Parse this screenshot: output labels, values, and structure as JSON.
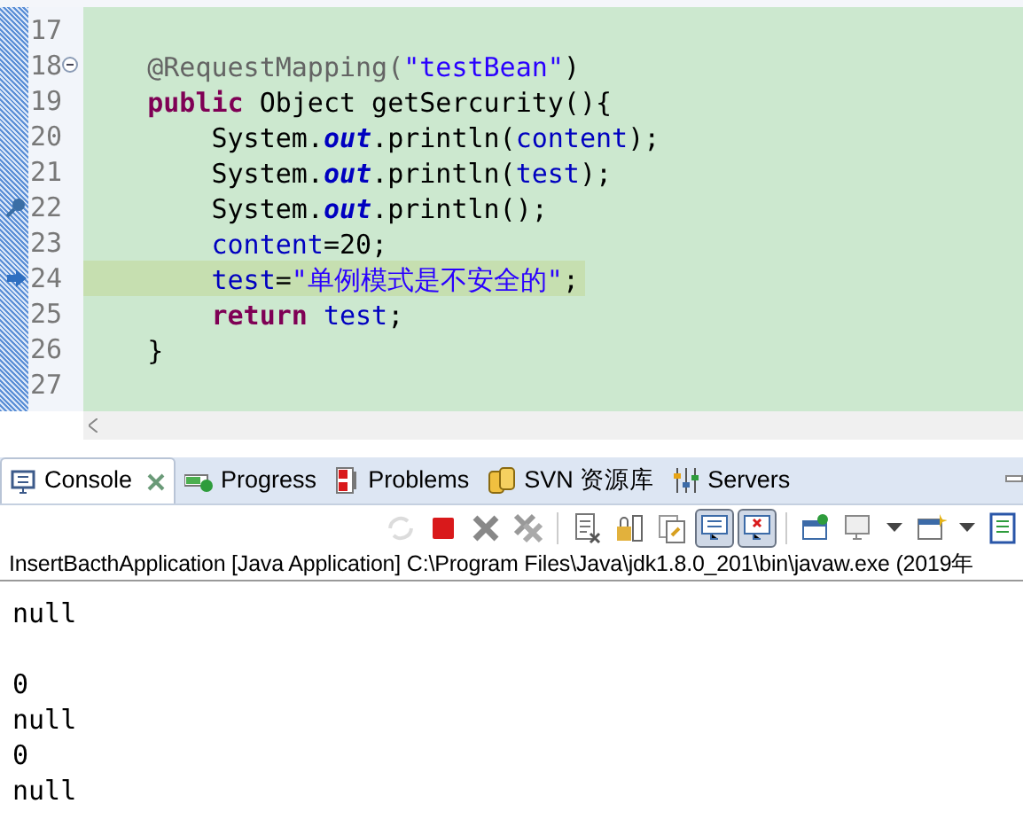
{
  "editor": {
    "lines": [
      {
        "number": "17",
        "fold_control": false,
        "breakpoint": false,
        "execution_arrow": false,
        "current": false
      },
      {
        "number": "18",
        "fold_control": true,
        "breakpoint": false,
        "execution_arrow": false,
        "current": false,
        "tokens": [
          {
            "kind": "annotation",
            "text": "    @RequestMapping("
          },
          {
            "kind": "string",
            "text": "\"testBean\""
          },
          {
            "kind": "plain",
            "text": ")"
          }
        ]
      },
      {
        "number": "19",
        "fold_control": false,
        "breakpoint": false,
        "execution_arrow": false,
        "current": false,
        "tokens": [
          {
            "kind": "keyword",
            "text": "    public"
          },
          {
            "kind": "plain",
            "text": " Object getSercurity(){"
          }
        ]
      },
      {
        "number": "20",
        "fold_control": false,
        "breakpoint": false,
        "execution_arrow": false,
        "current": false,
        "tokens": [
          {
            "kind": "plain",
            "text": "        System."
          },
          {
            "kind": "static",
            "text": "out"
          },
          {
            "kind": "plain",
            "text": ".println("
          },
          {
            "kind": "field",
            "text": "content"
          },
          {
            "kind": "plain",
            "text": ");"
          }
        ]
      },
      {
        "number": "21",
        "fold_control": false,
        "breakpoint": false,
        "execution_arrow": false,
        "current": false,
        "tokens": [
          {
            "kind": "plain",
            "text": "        System."
          },
          {
            "kind": "static",
            "text": "out"
          },
          {
            "kind": "plain",
            "text": ".println("
          },
          {
            "kind": "field",
            "text": "test"
          },
          {
            "kind": "plain",
            "text": ");"
          }
        ]
      },
      {
        "number": "22",
        "fold_control": false,
        "breakpoint": true,
        "execution_arrow": false,
        "current": false,
        "tokens": [
          {
            "kind": "plain",
            "text": "        System."
          },
          {
            "kind": "static",
            "text": "out"
          },
          {
            "kind": "plain",
            "text": ".println();"
          }
        ]
      },
      {
        "number": "23",
        "fold_control": false,
        "breakpoint": false,
        "execution_arrow": false,
        "current": false,
        "tokens": [
          {
            "kind": "field",
            "text": "        content"
          },
          {
            "kind": "plain",
            "text": "=20;"
          }
        ]
      },
      {
        "number": "24",
        "fold_control": false,
        "breakpoint": false,
        "execution_arrow": true,
        "current": true,
        "tokens": [
          {
            "kind": "field",
            "text": "        test"
          },
          {
            "kind": "plain",
            "text": "="
          },
          {
            "kind": "string",
            "text": "\"单例模式是不安全的\""
          },
          {
            "kind": "plain",
            "text": ";"
          }
        ]
      },
      {
        "number": "25",
        "fold_control": false,
        "breakpoint": false,
        "execution_arrow": false,
        "current": false,
        "tokens": [
          {
            "kind": "keyword",
            "text": "        return"
          },
          {
            "kind": "field",
            "text": " test"
          },
          {
            "kind": "plain",
            "text": ";"
          }
        ]
      },
      {
        "number": "26",
        "fold_control": false,
        "breakpoint": false,
        "execution_arrow": false,
        "current": false,
        "tokens": [
          {
            "kind": "plain",
            "text": "    }"
          }
        ]
      },
      {
        "number": "27",
        "fold_control": false,
        "breakpoint": false,
        "execution_arrow": false,
        "current": false
      }
    ]
  },
  "tabs": [
    {
      "label": "Console",
      "selected": true,
      "closable": true
    },
    {
      "label": "Progress",
      "selected": false,
      "closable": false
    },
    {
      "label": "Problems",
      "selected": false,
      "closable": false
    },
    {
      "label": "SVN 资源库",
      "selected": false,
      "closable": false
    },
    {
      "label": "Servers",
      "selected": false,
      "closable": false
    }
  ],
  "toolbar": [
    {
      "disabled": true,
      "pressed": false
    },
    {
      "disabled": false,
      "pressed": false
    },
    {
      "disabled": false,
      "pressed": false
    },
    {
      "disabled": false,
      "pressed": false
    },
    {
      "disabled": false,
      "pressed": false
    },
    {
      "disabled": false,
      "pressed": false
    },
    {
      "disabled": false,
      "pressed": false
    },
    {
      "disabled": false,
      "pressed": true
    },
    {
      "disabled": false,
      "pressed": true
    },
    {
      "disabled": false,
      "pressed": false
    },
    {
      "disabled": false,
      "pressed": false
    },
    {
      "disabled": false,
      "pressed": false
    },
    {
      "disabled": false,
      "pressed": false
    }
  ],
  "console": {
    "header": "InsertBacthApplication [Java Application] C:\\Program Files\\Java\\jdk1.8.0_201\\bin\\javaw.exe (2019年",
    "lines": [
      {
        "text": "null",
        "blank_before": false
      },
      {
        "text": "0",
        "blank_before": true
      },
      {
        "text": "null",
        "blank_before": false
      },
      {
        "text": "0",
        "blank_before": false
      },
      {
        "text": "null",
        "blank_before": false
      }
    ]
  }
}
